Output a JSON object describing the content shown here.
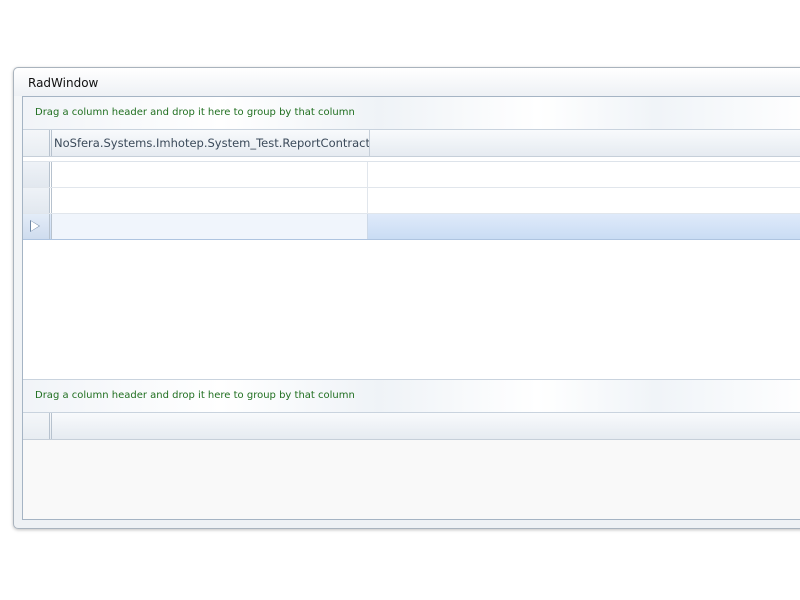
{
  "window": {
    "title": "RadWindow"
  },
  "grid_top": {
    "group_panel_text": "Drag a column header and drop it here to group by that column",
    "columns": [
      "NoSfera.Systems.Imhotep.System_Test.ReportContract"
    ],
    "rows": [
      {
        "cells": [
          ""
        ],
        "current": false
      },
      {
        "cells": [
          ""
        ],
        "current": false
      },
      {
        "cells": [
          ""
        ],
        "current": true
      }
    ]
  },
  "grid_bottom": {
    "group_panel_text": "Drag a column header and drop it here to group by that column"
  },
  "colors": {
    "group_text": "#206f20",
    "selected_row": "#c9dcf4",
    "border": "#a5b4c4"
  },
  "icons": {
    "current_row_indicator": "triangle-right-icon"
  }
}
